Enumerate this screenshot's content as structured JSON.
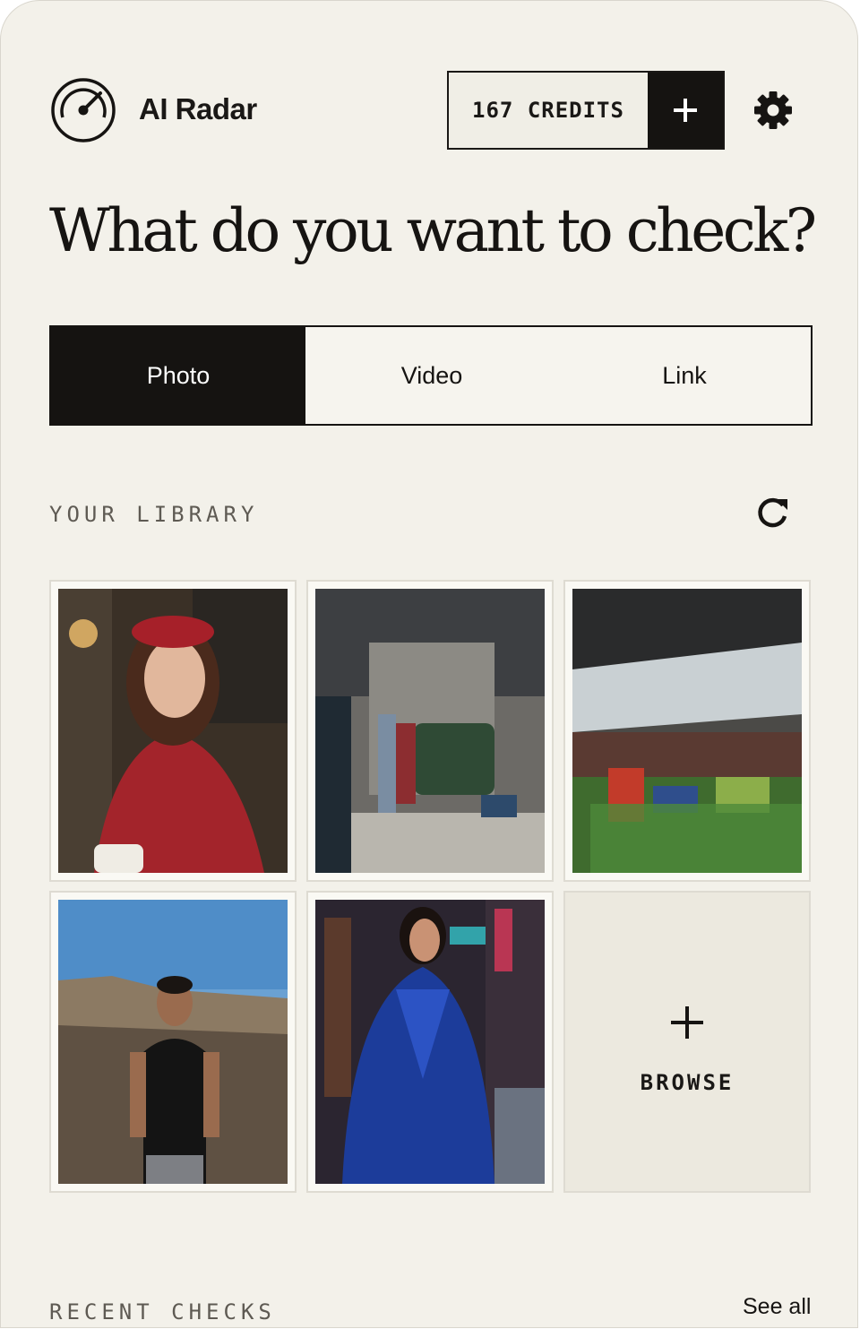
{
  "header": {
    "app_title": "AI Radar",
    "logo_icon": "radar-gauge-icon",
    "credits_label": "167 CREDITS",
    "add_credits_icon": "plus-icon",
    "settings_icon": "gear-icon"
  },
  "headline": "What do you want to check?",
  "tabs": [
    {
      "label": "Photo",
      "active": true
    },
    {
      "label": "Video",
      "active": false
    },
    {
      "label": "Link",
      "active": false
    }
  ],
  "library": {
    "section_label": "YOUR LIBRARY",
    "refresh_icon": "refresh-icon",
    "items": [
      {
        "subject": "woman-red-beret-cafe"
      },
      {
        "subject": "street-storefront-delivery"
      },
      {
        "subject": "covered-market-vegetables"
      },
      {
        "subject": "man-black-tshirt-rocks"
      },
      {
        "subject": "woman-blue-coat-neon-street"
      }
    ],
    "browse_icon": "plus-icon",
    "browse_label": "BROWSE"
  },
  "recent": {
    "section_label": "RECENT CHECKS",
    "see_all_label": "See all"
  },
  "colors": {
    "background": "#f3f1ea",
    "ink": "#161412",
    "muted_label": "#5e5a53",
    "tile_border": "#dedbd2",
    "browse_bg": "#ece9df"
  }
}
